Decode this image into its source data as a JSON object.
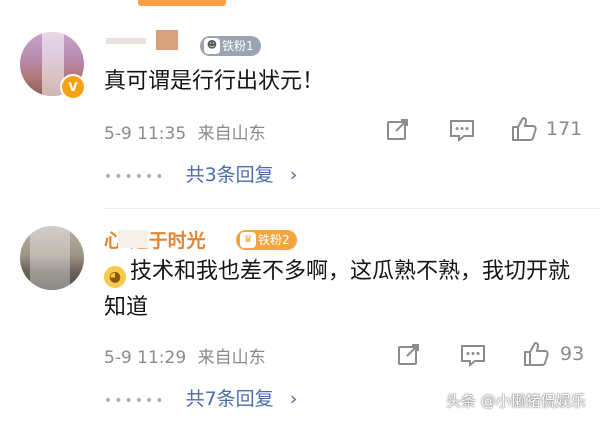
{
  "comments": [
    {
      "username": "",
      "fan_badge": "铁粉1",
      "text": "真可谓是行行出状元！",
      "date_time": "5-9 11:35",
      "source": "来自山东",
      "likes": "171",
      "replies_label": "共3条回复"
    },
    {
      "username": "心   之于时光",
      "fan_badge": "铁粉2",
      "text": "技术和我也差不多啊，这瓜熟不熟，我切开就知道",
      "date_time": "5-9 11:29",
      "source": "来自山东",
      "likes": "93",
      "replies_label": "共7条回复"
    }
  ],
  "watermark": "头条 @小懒猪侃娱乐",
  "colors": {
    "reply_link": "#4a6ea8",
    "meta_text": "#8a8a8a",
    "badge_1": "#9aa3b3",
    "badge_2": "#f2a541",
    "verified_badge": "#f7a215"
  },
  "icons": {
    "share": "share-icon",
    "comment": "comment-icon",
    "like": "thumbs-up-icon",
    "chevron": "chevron-right-icon",
    "verified": "verified-v-icon",
    "emoji": "doge-emoji-icon"
  }
}
